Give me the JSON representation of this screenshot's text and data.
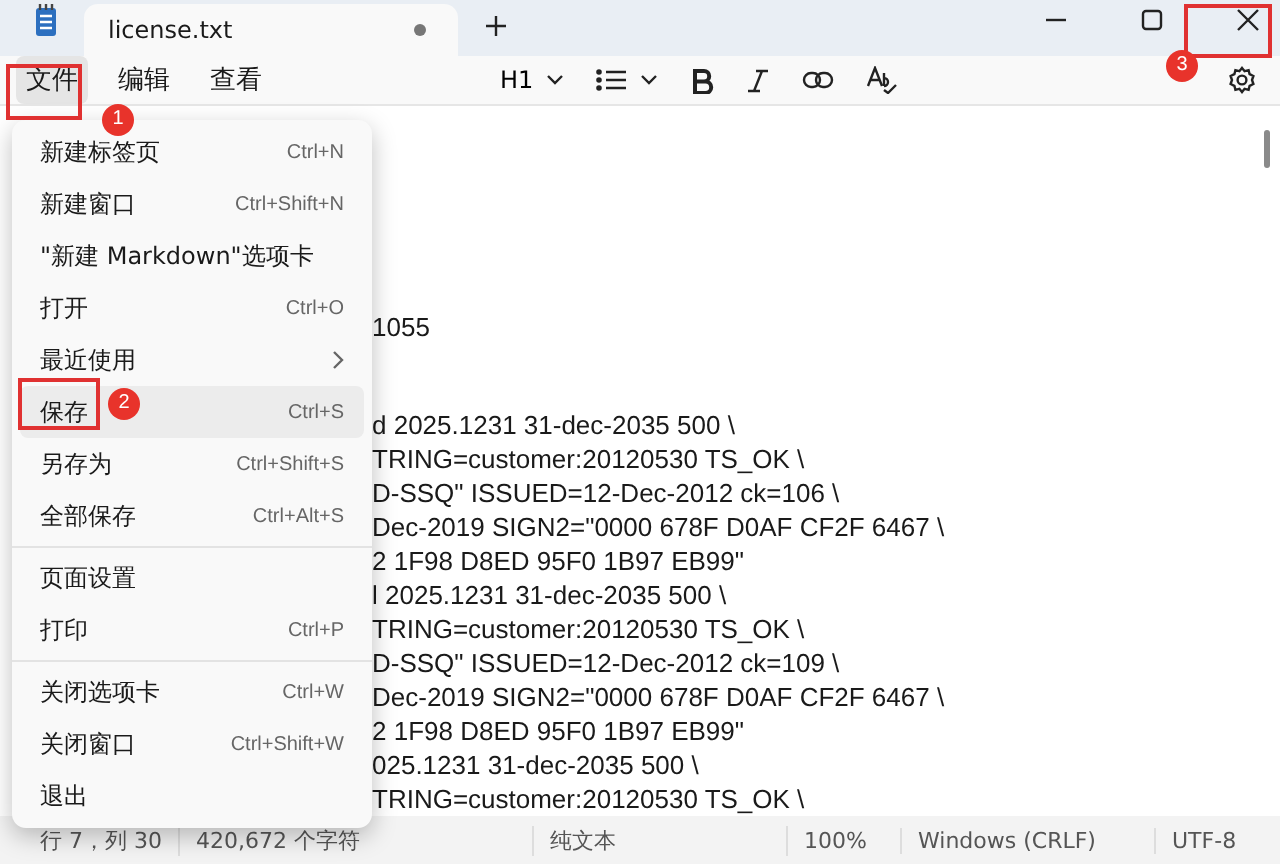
{
  "window": {
    "tab_title": "license.txt",
    "tab_unsaved": true
  },
  "menu_bar": [
    {
      "label": "文件",
      "selected": true
    },
    {
      "label": "编辑",
      "selected": false
    },
    {
      "label": "查看",
      "selected": false
    }
  ],
  "toolbar": {
    "heading": "H1"
  },
  "file_menu": [
    {
      "label": "新建标签页",
      "shortcut": "Ctrl+N",
      "selected": false,
      "kind": "item"
    },
    {
      "label": "新建窗口",
      "shortcut": "Ctrl+Shift+N",
      "selected": false,
      "kind": "item"
    },
    {
      "label": "\"新建 Markdown\"选项卡",
      "selected": false,
      "kind": "item"
    },
    {
      "label": "打开",
      "shortcut": "Ctrl+O",
      "selected": false,
      "kind": "item"
    },
    {
      "label": "最近使用",
      "selected": false,
      "kind": "submenu"
    },
    {
      "label": "保存",
      "shortcut": "Ctrl+S",
      "selected": true,
      "kind": "item"
    },
    {
      "label": "另存为",
      "shortcut": "Ctrl+Shift+S",
      "selected": false,
      "kind": "item"
    },
    {
      "label": "全部保存",
      "shortcut": "Ctrl+Alt+S",
      "selected": false,
      "kind": "item"
    },
    {
      "kind": "separator"
    },
    {
      "label": "页面设置",
      "selected": false,
      "kind": "item"
    },
    {
      "label": "打印",
      "shortcut": "Ctrl+P",
      "selected": false,
      "kind": "item"
    },
    {
      "kind": "separator"
    },
    {
      "label": "关闭选项卡",
      "shortcut": "Ctrl+W",
      "selected": false,
      "kind": "item"
    },
    {
      "label": "关闭窗口",
      "shortcut": "Ctrl+Shift+W",
      "selected": false,
      "kind": "item"
    },
    {
      "label": "退出",
      "selected": false,
      "kind": "item"
    }
  ],
  "editor_lines": [
    {
      "text": "1055",
      "gap_before": false
    },
    {
      "text": "d 2025.1231 31-dec-2035 500 \\",
      "gap_before": true
    },
    {
      "text": "TRING=customer:20120530 TS_OK \\",
      "gap_before": false
    },
    {
      "text": "D-SSQ\" ISSUED=12-Dec-2012 ck=106 \\",
      "gap_before": false
    },
    {
      "text": "Dec-2019 SIGN2=\"0000 678F D0AF CF2F 6467 \\",
      "gap_before": false
    },
    {
      "text": "2 1F98 D8ED 95F0 1B97 EB99\"",
      "gap_before": false
    },
    {
      "text": "l 2025.1231 31-dec-2035 500 \\",
      "gap_before": false
    },
    {
      "text": "TRING=customer:20120530 TS_OK \\",
      "gap_before": false
    },
    {
      "text": "D-SSQ\" ISSUED=12-Dec-2012 ck=109 \\",
      "gap_before": false
    },
    {
      "text": "Dec-2019 SIGN2=\"0000 678F D0AF CF2F 6467 \\",
      "gap_before": false
    },
    {
      "text": "2 1F98 D8ED 95F0 1B97 EB99\"",
      "gap_before": false
    },
    {
      "text": "025.1231 31-dec-2035 500 \\",
      "gap_before": false
    },
    {
      "text": "TRING=customer:20120530 TS_OK \\",
      "gap_before": false
    }
  ],
  "status_bar": {
    "position": "行 7，列 30",
    "characters": "420,672 个字符",
    "format": "纯文本",
    "zoom": "100%",
    "line_ending": "Windows (CRLF)",
    "encoding": "UTF-8"
  },
  "annotations": [
    {
      "kind": "file-menu",
      "label": "1"
    },
    {
      "kind": "save",
      "label": "2"
    },
    {
      "kind": "close",
      "label": "3"
    }
  ]
}
